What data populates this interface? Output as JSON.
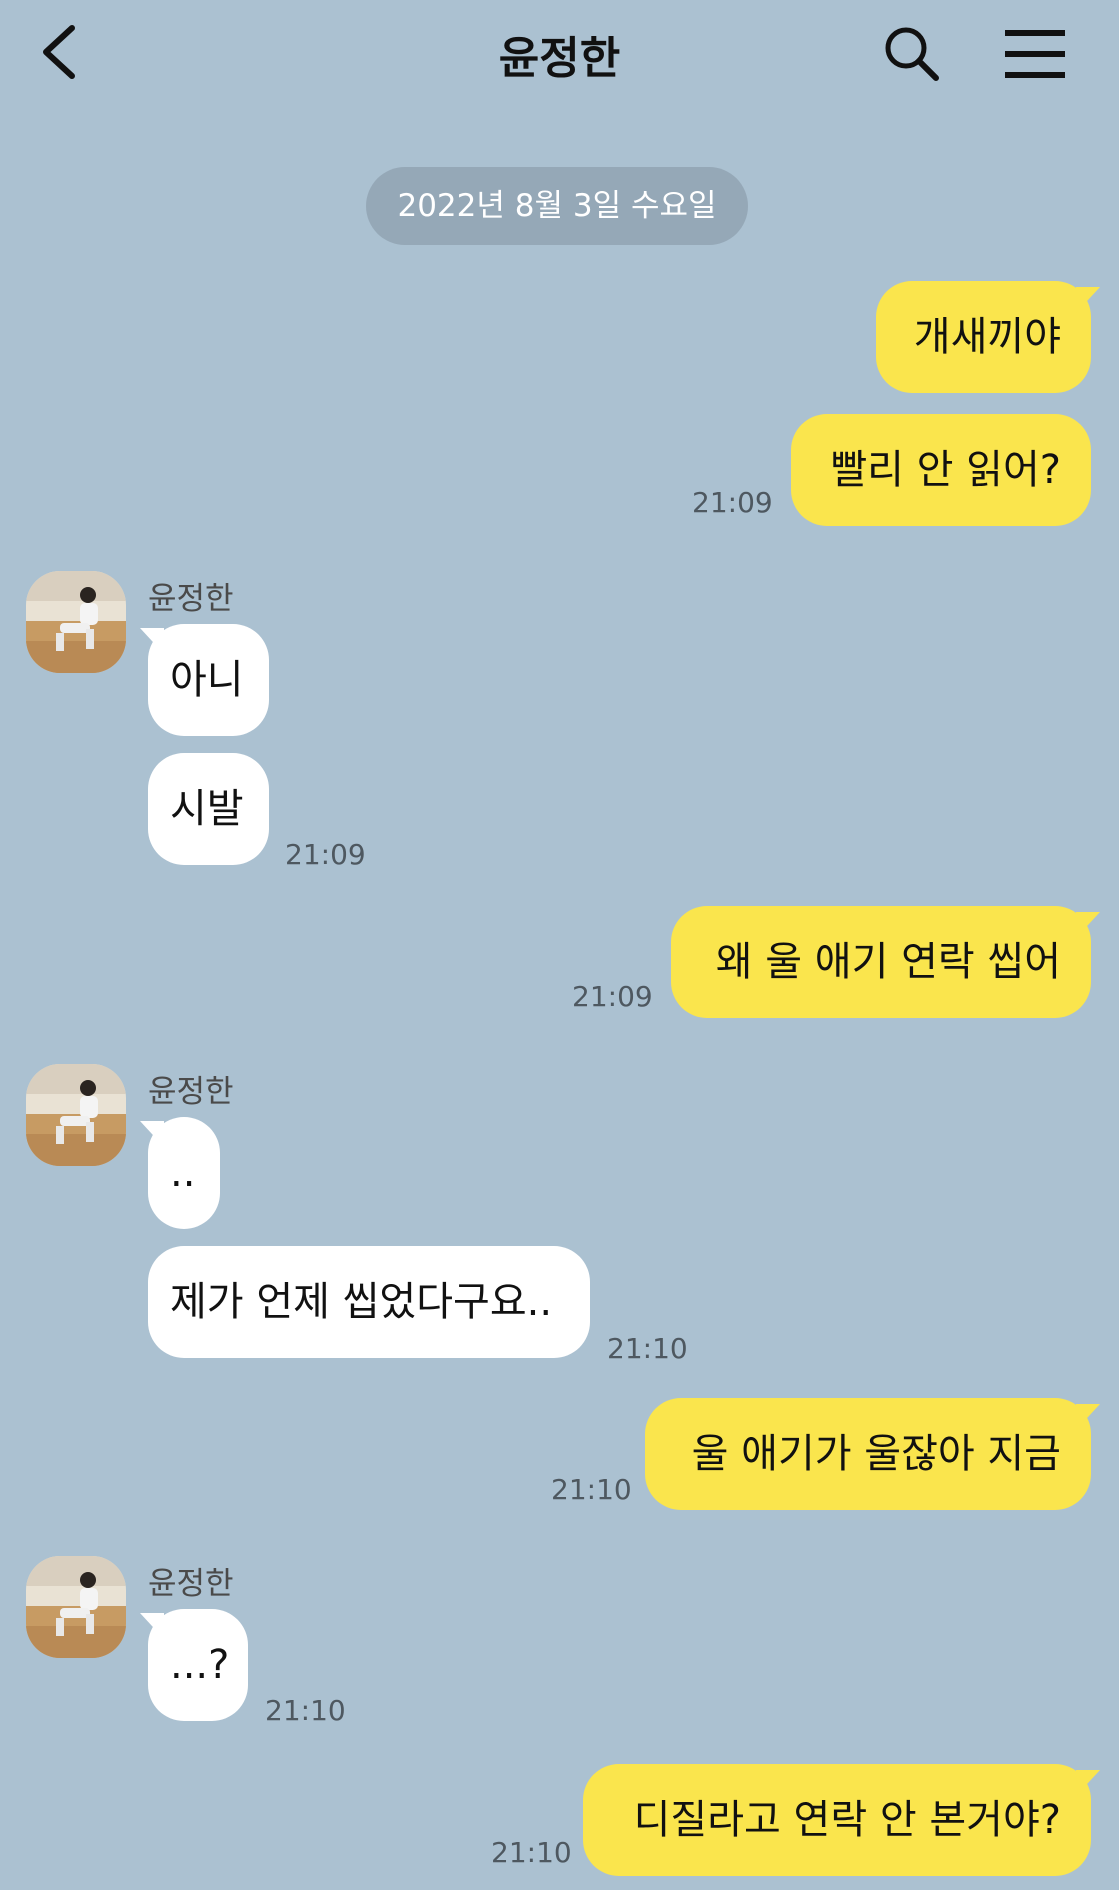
{
  "header": {
    "title": "윤정한"
  },
  "date_divider": "2022년 8월 3일 수요일",
  "contact_name": "윤정한",
  "messages": [
    {
      "from": "me",
      "text": "개새끼야"
    },
    {
      "from": "me",
      "text": "빨리 안 읽어?",
      "time": "21:09"
    },
    {
      "from": "them",
      "text": "아니"
    },
    {
      "from": "them",
      "text": "시발",
      "time": "21:09"
    },
    {
      "from": "me",
      "text": "왜 울 애기 연락 씹어",
      "time": "21:09"
    },
    {
      "from": "them",
      "text": ".."
    },
    {
      "from": "them",
      "text": "제가 언제 씹었다구요..",
      "time": "21:10"
    },
    {
      "from": "me",
      "text": "울 애기가 울잖아 지금",
      "time": "21:10"
    },
    {
      "from": "them",
      "text": "...?",
      "time": "21:10"
    },
    {
      "from": "me",
      "text": "디질라고 연락 안 본거야?",
      "time": "21:10"
    }
  ],
  "colors": {
    "background": "#abc1d1",
    "my_bubble": "#fae54d",
    "their_bubble": "#ffffff",
    "date_pill": "#95a8b7"
  },
  "icons": [
    "back-icon",
    "search-icon",
    "menu-icon"
  ]
}
